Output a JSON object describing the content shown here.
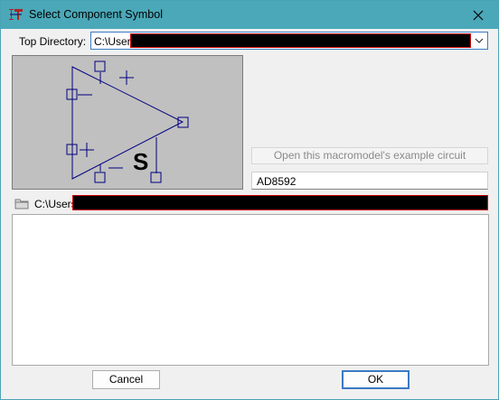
{
  "window": {
    "title": "Select Component Symbol"
  },
  "top_directory": {
    "label": "Top Directory:",
    "value": "C:\\Users"
  },
  "symbol_preview": {
    "marker": "S"
  },
  "example_button": {
    "label": "Open this macromodel's example circuit"
  },
  "component_name": {
    "value": "AD8592"
  },
  "current_path": {
    "value": "C:\\Users"
  },
  "buttons": {
    "cancel": "Cancel",
    "ok": "OK"
  },
  "colors": {
    "titlebar": "#4aa8b8",
    "symbol_line": "#000080",
    "preview_bg": "#c0c0c0",
    "redaction": "#000000",
    "redaction_border": "#cc0000"
  }
}
